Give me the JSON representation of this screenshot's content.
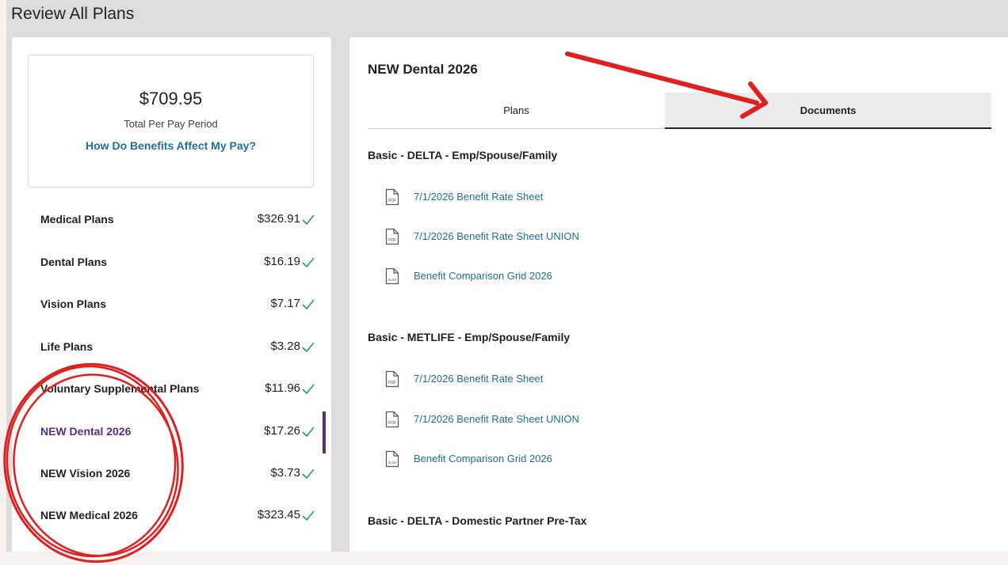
{
  "page": {
    "title": "Review All Plans"
  },
  "summary": {
    "total": "$709.95",
    "caption": "Total Per Pay Period",
    "link": "How Do Benefits Affect My Pay?"
  },
  "plans": [
    {
      "name": "Medical Plans",
      "amount": "$326.91"
    },
    {
      "name": "Dental Plans",
      "amount": "$16.19"
    },
    {
      "name": "Vision Plans",
      "amount": "$7.17"
    },
    {
      "name": "Life Plans",
      "amount": "$3.28"
    },
    {
      "name": "Voluntary Supplemental Plans",
      "amount": "$11.96"
    },
    {
      "name": "NEW Dental 2026",
      "amount": "$17.26",
      "active": true
    },
    {
      "name": "NEW Vision 2026",
      "amount": "$3.73"
    },
    {
      "name": "NEW Medical 2026",
      "amount": "$323.45"
    }
  ],
  "detail": {
    "title": "NEW Dental 2026",
    "tabs": {
      "plans": "Plans",
      "documents": "Documents",
      "selected": "Documents"
    },
    "sections": [
      {
        "heading": "Basic - DELTA - Emp/Spouse/Family",
        "documents": [
          {
            "label": "7/1/2026 Benefit Rate Sheet",
            "icon": "pdf-file-icon",
            "badge": "PDF"
          },
          {
            "label": "7/1/2026 Benefit Rate Sheet UNION",
            "icon": "pdf-file-icon",
            "badge": "PDF"
          },
          {
            "label": "Benefit Comparison Grid 2026",
            "icon": "xlsx-file-icon",
            "badge": "XLSX"
          }
        ]
      },
      {
        "heading": "Basic - METLIFE - Emp/Spouse/Family",
        "documents": [
          {
            "label": "7/1/2026 Benefit Rate Sheet",
            "icon": "pdf-file-icon",
            "badge": "PDF"
          },
          {
            "label": "7/1/2026 Benefit Rate Sheet UNION",
            "icon": "pdf-file-icon",
            "badge": "PDF"
          },
          {
            "label": "Benefit Comparison Grid 2026",
            "icon": "xlsx-file-icon",
            "badge": "XLSX"
          }
        ]
      },
      {
        "heading": "Basic - DELTA - Domestic Partner Pre-Tax",
        "documents": []
      }
    ]
  },
  "colors": {
    "accent_purple": "#5a2d82",
    "link_blue": "#1f6f9a",
    "check_green": "#2e9d57",
    "annotation_red": "#e02020"
  }
}
